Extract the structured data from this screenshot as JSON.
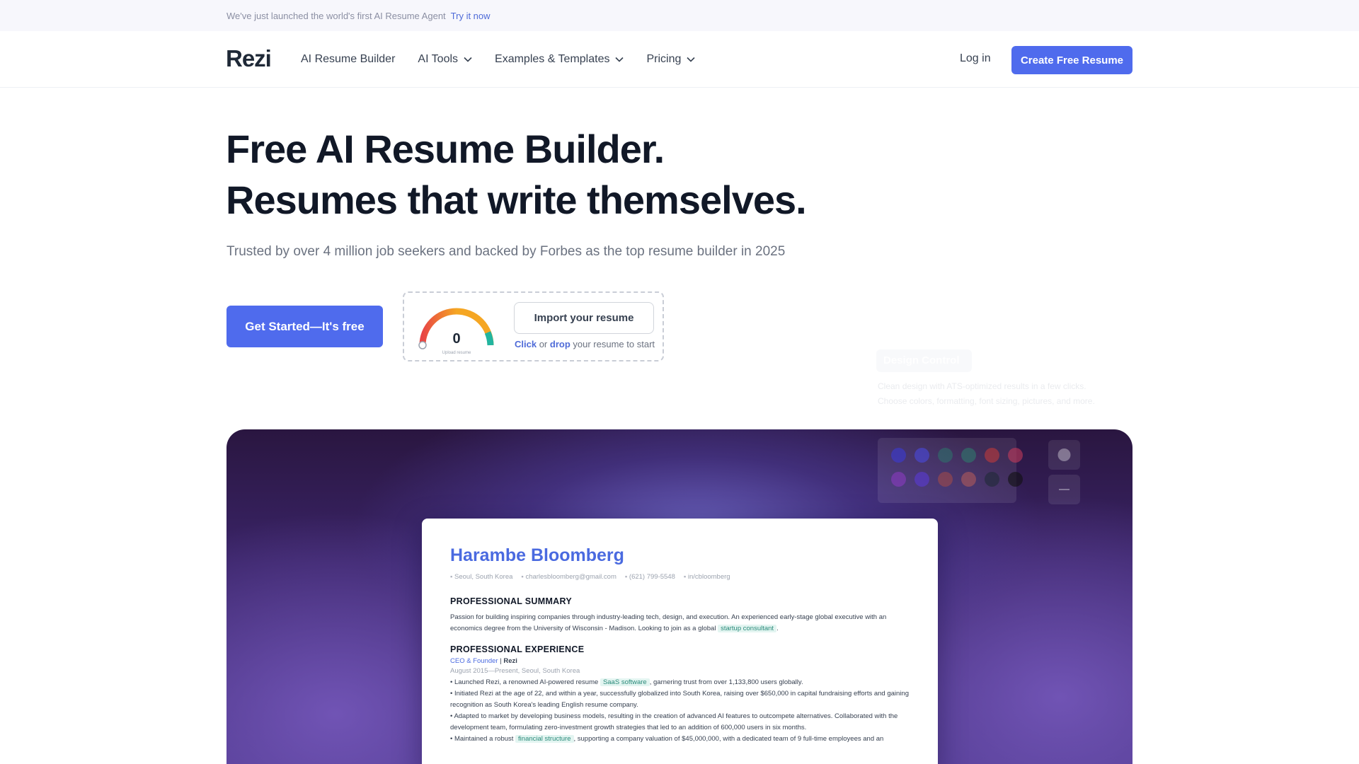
{
  "announcement": {
    "text": "We've just launched the world's first AI Resume Agent",
    "link": "Try it now"
  },
  "nav": {
    "logo": "Rezi",
    "items": [
      {
        "label": "AI Resume Builder",
        "dropdown": false
      },
      {
        "label": "AI Tools",
        "dropdown": true
      },
      {
        "label": "Examples & Templates",
        "dropdown": true
      },
      {
        "label": "Pricing",
        "dropdown": true
      }
    ],
    "login": "Log in",
    "cta": "Create Free Resume"
  },
  "hero": {
    "headline_1": "Free AI Resume Builder.",
    "headline_2": "Resumes that write themselves.",
    "subline": "Trusted by over 4 million job seekers and backed by Forbes as the top resume builder in 2025",
    "get_started": "Get Started—It's free"
  },
  "upload": {
    "score": "0",
    "score_caption": "Upload resume",
    "import_button": "Import your resume",
    "hint_click": "Click",
    "hint_or": "or",
    "hint_drop": "drop",
    "hint_rest": "your resume to start"
  },
  "design_control": {
    "title": "Design Control",
    "description": "Clean design with ATS-optimized results in a few clicks. Choose colors, formatting, font sizing, pictures, and more."
  },
  "colors": {
    "accent": "#4f6bed",
    "accent_text": "#4a6ae0",
    "heading": "#111827"
  },
  "swatches": [
    "#3b3bd6",
    "#4a4ae0",
    "#2f6f6a",
    "#2e7a6d",
    "#c03a3a",
    "#c23a5a",
    "#8a3ac0",
    "#5a3ad6",
    "#a04a4a",
    "#b05a5a",
    "#1f2937",
    "#111111"
  ],
  "resume": {
    "name": "Harambe Bloomberg",
    "contact": {
      "location": "Seoul, South Korea",
      "email": "charlesbloomberg@gmail.com",
      "phone": "(621) 799-5548",
      "linkedin": "in/cbloomberg"
    },
    "summary_heading": "PROFESSIONAL SUMMARY",
    "summary_text": "Passion for building inspiring companies through industry-leading tech, design, and execution. An experienced early-stage global executive with an economics degree from the University of Wisconsin - Madison. Looking to join as a global",
    "summary_highlight": "startup consultant",
    "summary_end": ".",
    "experience_heading": "PROFESSIONAL EXPERIENCE",
    "role": "CEO & Founder",
    "separator": " | ",
    "company": "Rezi",
    "dates": "August 2015—Present, Seoul, South Korea",
    "bullet1_pre": "• Launched Rezi, a renowned AI-powered resume",
    "bullet1_hl": "SaaS software",
    "bullet1_post": ", garnering trust from over 1,133,800 users globally.",
    "bullet2": "• Initiated Rezi at the age of 22, and within a year, successfully globalized into South Korea, raising over $650,000 in capital fundraising efforts and gaining recognition as South Korea's leading English resume company.",
    "bullet3": "• Adapted to market by developing business models, resulting in the creation of advanced AI features to outcompete alternatives. Collaborated with the development team, formulating zero-investment growth strategies that led to an addition of 600,000 users in six months.",
    "bullet4_pre": "• Maintained a robust",
    "bullet4_hl": "financial structure",
    "bullet4_post": ", supporting a company valuation of $45,000,000, with a dedicated team of 9 full-time employees and an"
  }
}
